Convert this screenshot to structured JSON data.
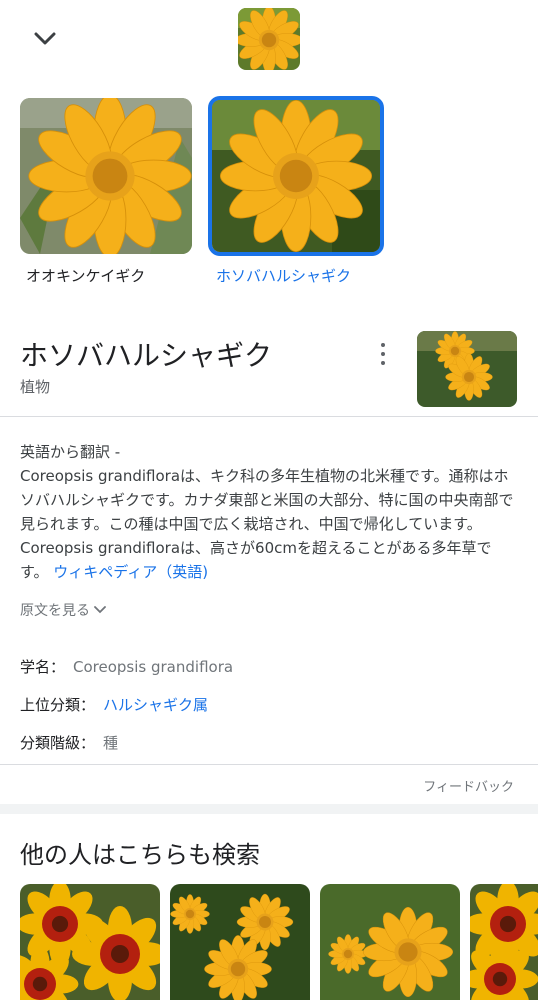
{
  "top_nav": {
    "back_icon": "chevron-down-icon"
  },
  "images": [
    {
      "label": "オオキンケイギク",
      "selected": false
    },
    {
      "label": "ホソバハルシャギク",
      "selected": true
    }
  ],
  "knowledge_panel": {
    "title": "ホソバハルシャギク",
    "subtitle": "植物",
    "more_icon": "more-vert-icon"
  },
  "description": {
    "prefix": "英語から翻訳 -",
    "text": "Coreopsis grandifloraは、キク科の多年生植物の北米種です。通称はホソバハルシャギクです。カナダ東部と米国の大部分、特に国の中央南部で見られます。この種は中国で広く栽培され、中国で帰化しています。 Coreopsis grandifloraは、高さが60cmを超えることがある多年草です。",
    "source": "ウィキペディア（英語)",
    "show_original": "原文を見る"
  },
  "facts": [
    {
      "key": "学名：",
      "value": "Coreopsis grandiflora"
    },
    {
      "key": "上位分類：",
      "value": "ハルシャギク属"
    },
    {
      "key": "分類階級：",
      "value": "種"
    }
  ],
  "feedback": "フィードバック",
  "people_also_search": {
    "title": "他の人はこちらも検索"
  },
  "colors": {
    "accent": "#1a73e8",
    "flower_yellow": "#f7b515"
  }
}
